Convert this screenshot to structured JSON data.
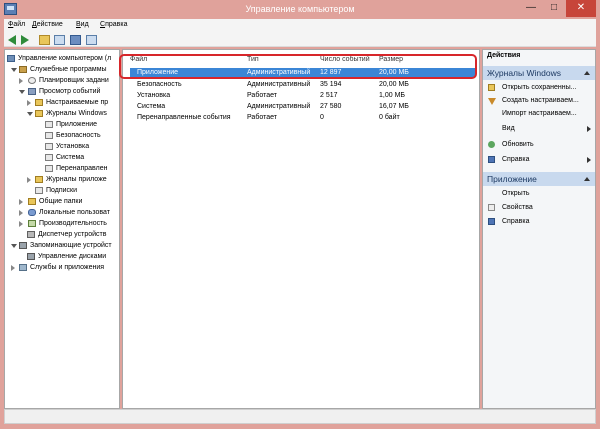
{
  "window": {
    "title": "Управление компьютером"
  },
  "menu": [
    {
      "key": "Ф",
      "rest": "айл"
    },
    {
      "key": "Д",
      "rest": "ействие"
    },
    {
      "key": "В",
      "rest": "ид"
    },
    {
      "key": "С",
      "rest": "правка"
    }
  ],
  "toolbar": {
    "icons": [
      "back-arrow-icon",
      "forward-arrow-icon",
      "folder-up-icon",
      "show-hide-tree-icon",
      "help-icon",
      "action-pane-icon"
    ]
  },
  "tree": [
    {
      "label": "Управление компьютером (л",
      "icon": "computer-icon"
    },
    {
      "label": "Служебные программы",
      "icon": "tools-icon"
    },
    {
      "label": "Планировщик задани",
      "icon": "clock-icon"
    },
    {
      "label": "Просмотр событий",
      "icon": "event-viewer-icon"
    },
    {
      "label": "Настраиваемые пр",
      "icon": "folder-icon"
    },
    {
      "label": "Журналы Windows",
      "icon": "folder-icon"
    },
    {
      "label": "Приложение",
      "icon": "log-icon"
    },
    {
      "label": "Безопасность",
      "icon": "log-icon"
    },
    {
      "label": "Установка",
      "icon": "log-icon"
    },
    {
      "label": "Система",
      "icon": "log-icon"
    },
    {
      "label": "Перенаправлен",
      "icon": "log-icon"
    },
    {
      "label": "Журналы приложе",
      "icon": "folder-icon"
    },
    {
      "label": "Подписки",
      "icon": "log-icon"
    },
    {
      "label": "Общие папки",
      "icon": "shared-folder-icon"
    },
    {
      "label": "Локальные пользоват",
      "icon": "users-icon"
    },
    {
      "label": "Производительность",
      "icon": "performance-icon"
    },
    {
      "label": "Диспетчер устройств",
      "icon": "device-manager-icon"
    },
    {
      "label": "Запоминающие устройст",
      "icon": "storage-icon"
    },
    {
      "label": "Управление дисками",
      "icon": "disk-icon"
    },
    {
      "label": "Службы и приложения",
      "icon": "services-icon"
    }
  ],
  "table": {
    "columns": [
      "Файл",
      "Тип",
      "Число событий",
      "Размер"
    ],
    "rows": [
      {
        "name": "Приложение",
        "type": "Административный",
        "count": "12 897",
        "size": "20,00 МБ",
        "selected": true
      },
      {
        "name": "Безопасность",
        "type": "Административный",
        "count": "35 194",
        "size": "20,00 МБ",
        "selected": false
      },
      {
        "name": "Установка",
        "type": "Работает",
        "count": "2 517",
        "size": "1,00 МБ",
        "selected": false
      },
      {
        "name": "Система",
        "type": "Административный",
        "count": "27 580",
        "size": "16,07 МБ",
        "selected": false
      },
      {
        "name": "Перенаправленные события",
        "type": "Работает",
        "count": "0",
        "size": "0 байт",
        "selected": false
      }
    ]
  },
  "actions": {
    "title": "Действия",
    "sections": [
      {
        "header": "Журналы Windows",
        "items": [
          {
            "label": "Открыть сохраненны...",
            "icon": "open-saved-log-icon",
            "submenu": false
          },
          {
            "label": "Создать настраиваем...",
            "icon": "filter-icon",
            "submenu": false
          },
          {
            "label": "Импорт настраиваем...",
            "icon": "",
            "submenu": false
          },
          {
            "label": "Вид",
            "icon": "",
            "submenu": true
          },
          {
            "label": "Обновить",
            "icon": "refresh-icon",
            "submenu": false
          },
          {
            "label": "Справка",
            "icon": "help-icon",
            "submenu": true
          }
        ]
      },
      {
        "header": "Приложение",
        "items": [
          {
            "label": "Открыть",
            "icon": "",
            "submenu": false
          },
          {
            "label": "Свойства",
            "icon": "properties-icon",
            "submenu": false
          },
          {
            "label": "Справка",
            "icon": "help-icon",
            "submenu": false
          }
        ]
      }
    ]
  },
  "colors": {
    "title_bar": "#e0a29b",
    "selection": "#3b86d6",
    "highlight_box": "#d7262a",
    "section_header": "#c8d9ee"
  }
}
